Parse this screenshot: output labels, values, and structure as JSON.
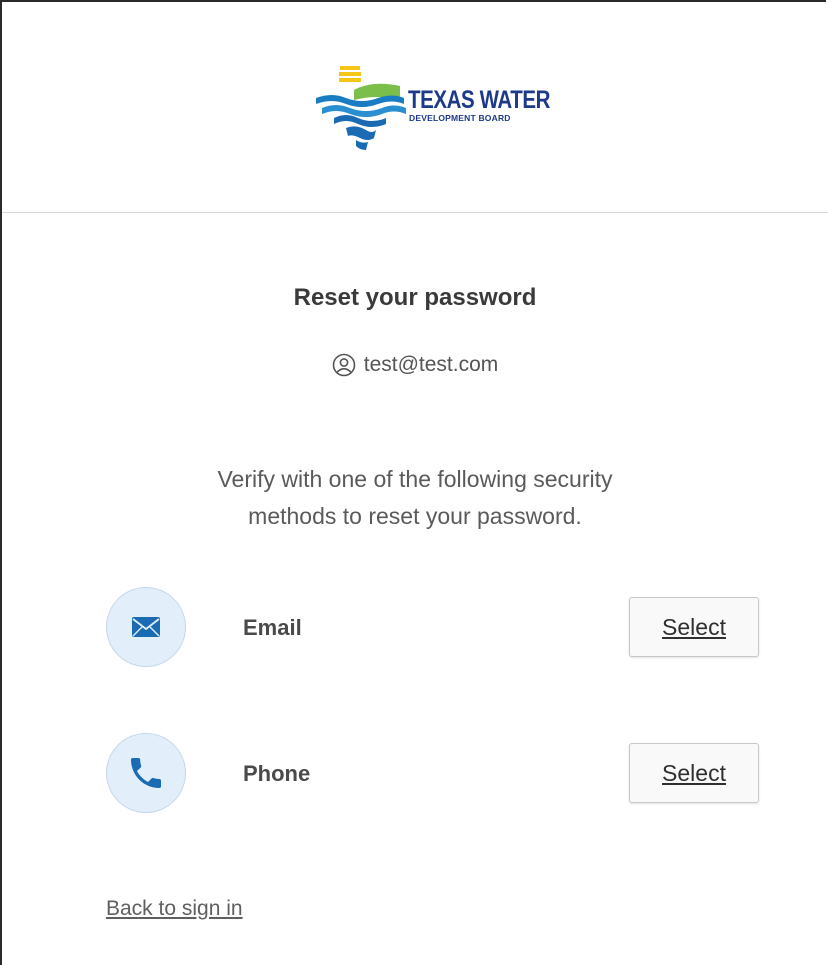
{
  "brand": {
    "logo_line1": "TEXAS WATER",
    "logo_line2": "DEVELOPMENT BOARD"
  },
  "page": {
    "title": "Reset your password",
    "username": "test@test.com",
    "description_line1": "Verify with one of the following security",
    "description_line2": "methods to reset your password."
  },
  "methods": [
    {
      "label": "Email",
      "icon": "envelope-icon",
      "button_label": "Select"
    },
    {
      "label": "Phone",
      "icon": "phone-icon",
      "button_label": "Select"
    }
  ],
  "footer": {
    "back_link": "Back to sign in"
  },
  "colors": {
    "icon_bg": "#e2effa",
    "icon_blue": "#1a6bb3",
    "logo_navy": "#1d3a8a",
    "logo_yellow": "#f5c518",
    "logo_green": "#7bbf4a"
  }
}
